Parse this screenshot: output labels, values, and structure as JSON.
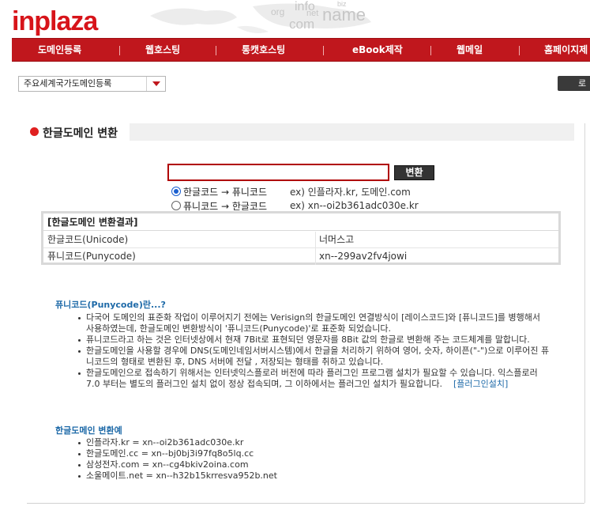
{
  "header": {
    "logo_text": "inplaza",
    "map_words": [
      "org",
      "info",
      "net",
      "biz",
      "name",
      "com"
    ]
  },
  "nav": {
    "items": [
      "도메인등록",
      "웹호스팅",
      "통캣호스팅",
      "eBook제작",
      "웹메일",
      "홈페이지제"
    ]
  },
  "toolbar": {
    "select_value": "주요세계국가도메인등록",
    "login_label": "로"
  },
  "section": {
    "title": "한글도메인 변환"
  },
  "converter": {
    "input_value": "",
    "button_label": "변환",
    "options": [
      {
        "label": "한글코드 → 퓨니코드",
        "example": "ex) 인플라자.kr, 도메인.com",
        "checked": true
      },
      {
        "label": "퓨니코드 → 한글코드",
        "example": "ex) xn--oi2b361adc030e.kr",
        "checked": false
      }
    ]
  },
  "result": {
    "heading": "[한글도메인 변환결과]",
    "rows": [
      {
        "label": "한글코드(Unicode)",
        "value": "너머스고"
      },
      {
        "label": "퓨니코드(Punycode)",
        "value": "xn--299av2fv4jowi"
      }
    ]
  },
  "info": {
    "title": "퓨니코드(Punycode)란...?",
    "items": [
      "다국어 도메인의 표준화 작업이 이루어지기 전에는 Verisign의 한글도메인 연결방식이 [레이스코드]와 [퓨니코드]를 병행해서 사용하였는데, 한글도메인 변환방식이 '퓨니코드(Punycode)'로 표준화 되었습니다.",
      "퓨니코드라고 하는 것은 인터넷상에서 현재 7Bit로 표현되던 영문자를 8Bit 값의 한글로 변환해 주는 코드체계를 말합니다.",
      "한글도메인을 사용할 경우에 DNS(도메인네임서버시스템)에서 한글을 처리하기 위하여 영어, 숫자, 하이픈(\"-\")으로 이루어진 퓨니코드의 형태로 변환된 후, DNS 서버에 전달 , 저장되는 형태를 취하고 있습니다.",
      "한글도메인으로 접속하기 위해서는 인터넷익스플로러 버전에 따라 플러그인 프로그램 설치가 필요할 수 있습니다. 익스플로러7.0 부터는 별도의 플러그인 설치 없이 정상 접속되며, 그 이하에서는 플러그인 설치가 필요합니다."
    ],
    "plugin_link": "[플러그인설치]"
  },
  "examples": {
    "title": "한글도메인 변환예",
    "items": [
      "인플라자.kr = xn--oi2b361adc030e.kr",
      "한글도메인.cc = xn--bj0bj3i97fq8o5lq.cc",
      "삼성전자.com = xn--cg4bkiv2oina.com",
      "소울메이트.net = xn--h32b15krresva952b.net"
    ]
  }
}
